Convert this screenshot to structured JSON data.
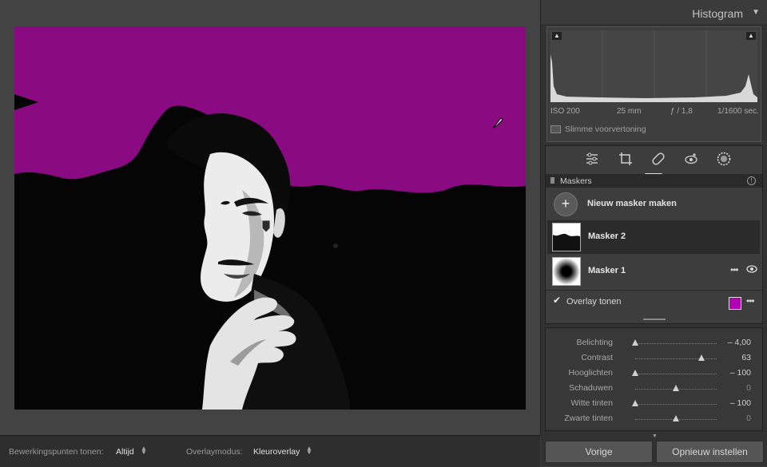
{
  "histogram": {
    "title": "Histogram",
    "iso": "ISO 200",
    "focal": "25 mm",
    "aperture": "ƒ / 1,8",
    "shutter": "1/1600 sec.",
    "smart_preview": "Slimme voorvertoning"
  },
  "masks": {
    "header": "Maskers",
    "new_mask": "Nieuw masker maken",
    "items": [
      {
        "name": "Masker 2"
      },
      {
        "name": "Masker 1"
      }
    ],
    "overlay_label": "Overlay tonen",
    "overlay_color": "#b000b0"
  },
  "adjustments": {
    "sliders": [
      {
        "label": "Belichting",
        "value": "– 4,00",
        "level": -1.0
      },
      {
        "label": "Contrast",
        "value": "63",
        "level": 0.63
      },
      {
        "label": "Hooglichten",
        "value": "– 100",
        "level": -1.0
      },
      {
        "label": "Schaduwen",
        "value": "0",
        "level": 0
      },
      {
        "label": "Witte tinten",
        "value": "– 100",
        "level": -1.0
      },
      {
        "label": "Zwarte tinten",
        "value": "0",
        "level": 0
      }
    ]
  },
  "buttons": {
    "previous": "Vorige",
    "reset": "Opnieuw instellen"
  },
  "toolbar": {
    "edit_pins_label": "Bewerkingspunten tonen:",
    "edit_pins_value": "Altijd",
    "overlay_mode_label": "Overlaymodus:",
    "overlay_mode_value": "Kleuroverlay"
  }
}
